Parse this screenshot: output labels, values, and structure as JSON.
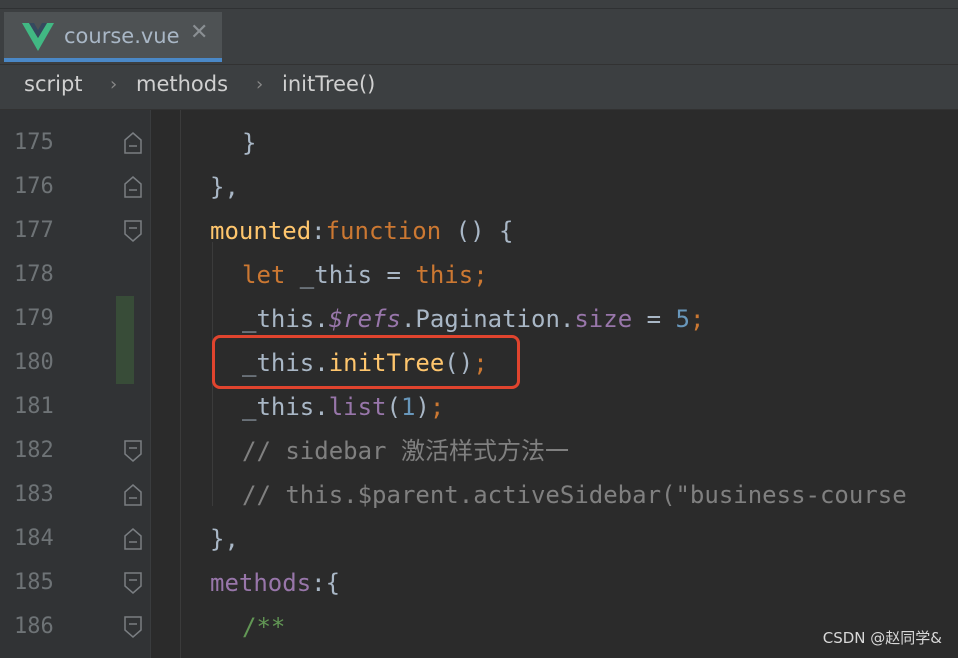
{
  "tab": {
    "label": "course.vue",
    "close_glyph": "✕",
    "icon": "vue-logo-icon"
  },
  "breadcrumb": {
    "items": [
      "script",
      "methods",
      "initTree()"
    ],
    "separator": "›"
  },
  "gutter": {
    "line_numbers": [
      "175",
      "176",
      "177",
      "178",
      "179",
      "180",
      "181",
      "182",
      "183",
      "184",
      "185",
      "186"
    ]
  },
  "code_lines": [
    {
      "tokens": [
        {
          "t": "}",
          "c": "plain"
        }
      ]
    },
    {
      "tokens": [
        {
          "t": "},",
          "c": "plain"
        }
      ]
    },
    {
      "tokens": [
        {
          "t": "mounted",
          "c": "fn"
        },
        {
          "t": ":",
          "c": "plain"
        },
        {
          "t": "function",
          "c": "kw"
        },
        {
          "t": " () {",
          "c": "plain"
        }
      ]
    },
    {
      "tokens": [
        {
          "t": "let",
          "c": "kw"
        },
        {
          "t": " _this = ",
          "c": "plain"
        },
        {
          "t": "this",
          "c": "kw"
        },
        {
          "t": ";",
          "c": "kw"
        }
      ]
    },
    {
      "tokens": [
        {
          "t": "_this.",
          "c": "plain"
        },
        {
          "t": "$refs",
          "c": "method"
        },
        {
          "t": ".Pagination.",
          "c": "plain"
        },
        {
          "t": "size",
          "c": "prop"
        },
        {
          "t": " = ",
          "c": "plain"
        },
        {
          "t": "5",
          "c": "num"
        },
        {
          "t": ";",
          "c": "kw"
        }
      ]
    },
    {
      "tokens": [
        {
          "t": "_this.",
          "c": "plain"
        },
        {
          "t": "initTree",
          "c": "fn"
        },
        {
          "t": "()",
          "c": "plain"
        },
        {
          "t": ";",
          "c": "kw"
        }
      ]
    },
    {
      "tokens": [
        {
          "t": "_this.",
          "c": "plain"
        },
        {
          "t": "list",
          "c": "prop"
        },
        {
          "t": "(",
          "c": "plain"
        },
        {
          "t": "1",
          "c": "num"
        },
        {
          "t": ")",
          "c": "plain"
        },
        {
          "t": ";",
          "c": "kw"
        }
      ]
    },
    {
      "tokens": [
        {
          "t": "// sidebar 激活样式方法一",
          "c": "comment"
        }
      ]
    },
    {
      "tokens": [
        {
          "t": "// this.$parent.activeSidebar(\"business-course",
          "c": "comment"
        }
      ]
    },
    {
      "tokens": [
        {
          "t": "},",
          "c": "plain"
        }
      ]
    },
    {
      "tokens": [
        {
          "t": "methods",
          "c": "prop"
        },
        {
          "t": ":{",
          "c": "plain"
        }
      ]
    },
    {
      "tokens": [
        {
          "t": "/**",
          "c": "doc"
        }
      ]
    }
  ],
  "watermark": "CSDN @赵同学&",
  "colors": {
    "highlight": "#e0442e",
    "accent": "#4a88c7",
    "vue_green": "#41b883",
    "vue_dark": "#35495e"
  }
}
